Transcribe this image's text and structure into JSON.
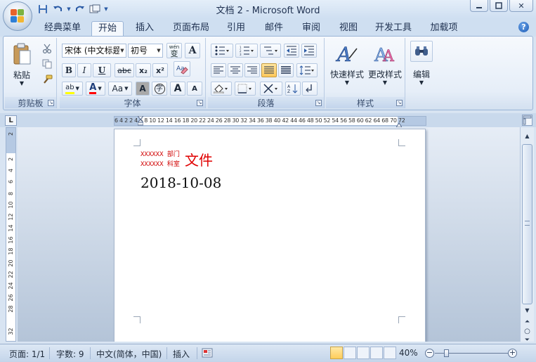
{
  "window": {
    "title": "文档 2 - Microsoft Word",
    "minimize_icon": "minimize-icon",
    "restore_icon": "restore-icon",
    "close_glyph": "✕"
  },
  "quick_access": {
    "save_icon": "save-icon",
    "undo_icon": "undo-icon",
    "redo_icon": "redo-icon",
    "customize_icon": "customize-icon"
  },
  "tabs": [
    {
      "label": "经典菜单"
    },
    {
      "label": "开始",
      "active": true
    },
    {
      "label": "插入"
    },
    {
      "label": "页面布局"
    },
    {
      "label": "引用"
    },
    {
      "label": "邮件"
    },
    {
      "label": "审阅"
    },
    {
      "label": "视图"
    },
    {
      "label": "开发工具"
    },
    {
      "label": "加载项"
    }
  ],
  "ribbon": {
    "clipboard": {
      "label": "剪贴板",
      "paste": "粘贴"
    },
    "font": {
      "label": "字体",
      "font_name": "宋体 (中文标题",
      "font_size": "初号",
      "wen_glyph": "wén\n变",
      "a_glyph": "A",
      "bold": "B",
      "italic": "I",
      "underline": "U",
      "strike": "abc",
      "subscript": "x₂",
      "superscript": "x²",
      "clear_format": "Aa",
      "char_shading": "A",
      "enclose": "字",
      "grow": "A",
      "shrink": "A",
      "highlight": "ab",
      "font_color": "A",
      "highlight_color": "#ffff00",
      "font_color_value": "#ff0000"
    },
    "paragraph": {
      "label": "段落"
    },
    "styles": {
      "label": "样式",
      "quick_styles": "快速样式",
      "change_styles": "更改样式"
    },
    "editing": {
      "label": "编辑"
    }
  },
  "ruler": {
    "h_text": "6  4  2    2  4  6  8 10 12 14 16 18 20 22 24 26 28 30 32 34 36 38 40 42 44 46 48 50 52 54 56 58 60 62 64    68 70 72",
    "v_ticks": [
      "2",
      "2",
      "4",
      "6",
      "8",
      "10",
      "12",
      "14",
      "16",
      "18",
      "20",
      "22",
      "24",
      "26",
      "28",
      "32"
    ],
    "corner_glyph": "L"
  },
  "document": {
    "header_line1": "XXXXXX 部门",
    "header_line2": "XXXXXX  科室",
    "header_big": "文件",
    "date": "2018-10-08"
  },
  "statusbar": {
    "page": "页面: 1/1",
    "words": "字数: 9",
    "language": "中文(简体，中国)",
    "mode": "插入",
    "zoom": "40%",
    "zoom_minus": "−",
    "zoom_plus": "+",
    "zoom_level": 0.4
  }
}
